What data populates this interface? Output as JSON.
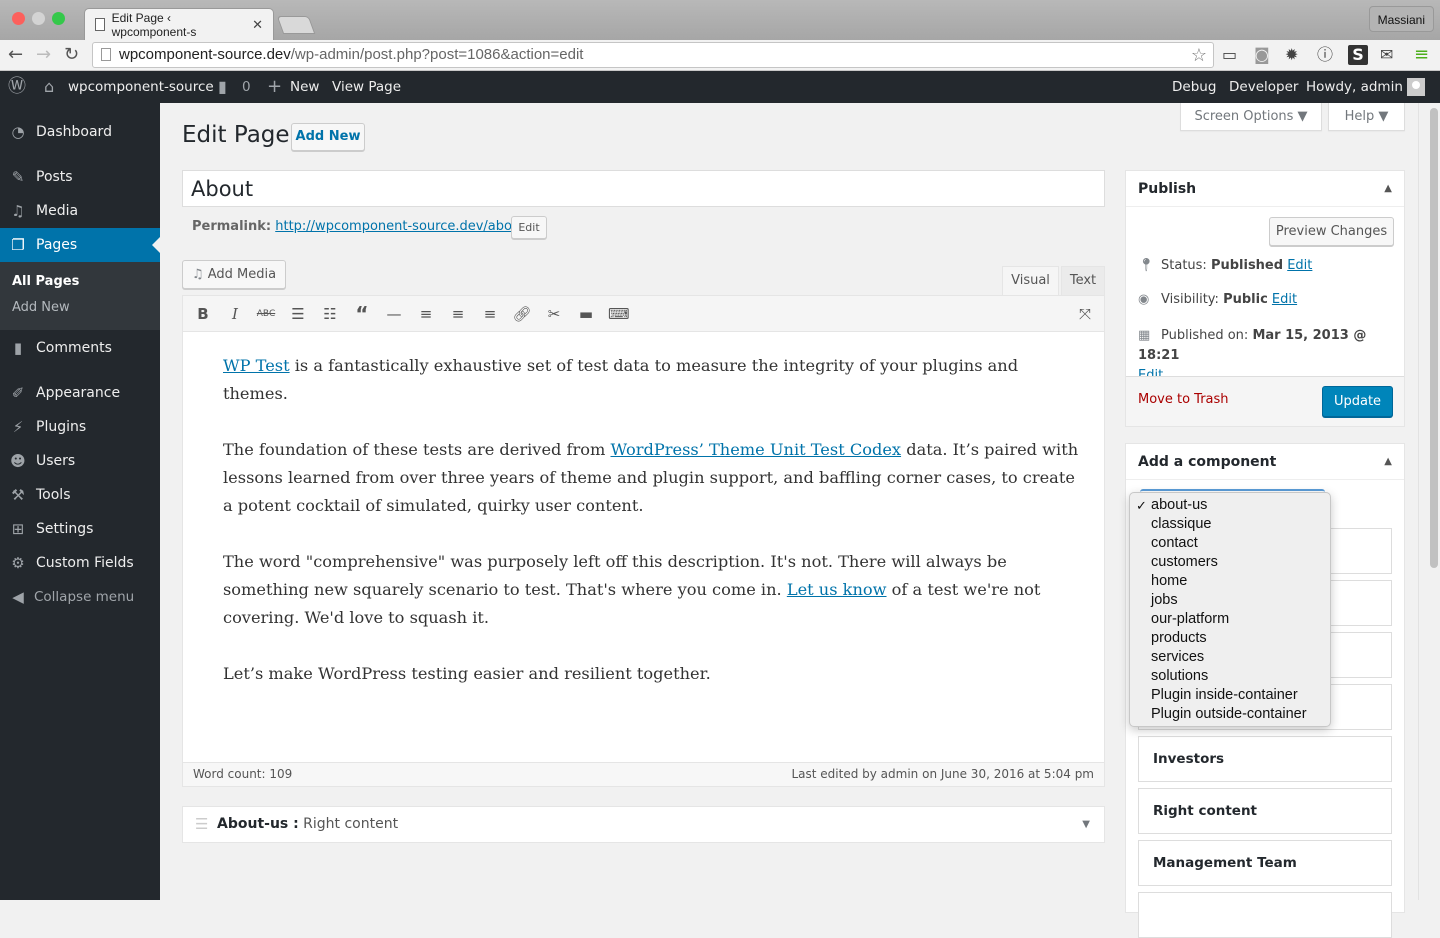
{
  "browser": {
    "tab_title": "Edit Page ‹ wpcomponent-s",
    "profile": "Massiani",
    "url_host": "wpcomponent-source.dev",
    "url_path": "/wp-admin/post.php?post=1086&action=edit"
  },
  "adminbar": {
    "site": "wpcomponent-source",
    "comments": "0",
    "new": "New",
    "view": "View Page",
    "debug": "Debug",
    "developer": "Developer",
    "howdy": "Howdy, admin"
  },
  "sidebar": {
    "items": [
      {
        "label": "Dashboard",
        "icon": "dashboard-icon"
      },
      {
        "label": "Posts",
        "icon": "pin-icon"
      },
      {
        "label": "Media",
        "icon": "media-icon"
      },
      {
        "label": "Pages",
        "icon": "pages-icon"
      },
      {
        "label": "Comments",
        "icon": "comment-icon"
      },
      {
        "label": "Appearance",
        "icon": "brush-icon"
      },
      {
        "label": "Plugins",
        "icon": "plug-icon"
      },
      {
        "label": "Users",
        "icon": "user-icon"
      },
      {
        "label": "Tools",
        "icon": "wrench-icon"
      },
      {
        "label": "Settings",
        "icon": "settings-icon"
      },
      {
        "label": "Custom Fields",
        "icon": "gear-icon"
      }
    ],
    "submenu": [
      "All Pages",
      "Add New"
    ],
    "collapse": "Collapse menu"
  },
  "screen_options": "Screen Options ▼",
  "help": "Help ▼",
  "page": {
    "heading": "Edit Page",
    "add_new": "Add New",
    "title_value": "About",
    "permalink_label": "Permalink:",
    "permalink_url": "http://wpcomponent-source.dev/about/",
    "permalink_edit": "Edit",
    "add_media": "Add Media",
    "tab_visual": "Visual",
    "tab_text": "Text"
  },
  "content": {
    "p1_link": "WP Test",
    "p1_rest": " is a fantastically exhaustive set of test data to measure the integrity of your plugins and themes.",
    "p2_a": "The foundation of these tests are derived from ",
    "p2_link": "WordPress’ Theme Unit Test Codex",
    "p2_b": " data. It’s paired with lessons learned from over three years of theme and plugin support, and baffling corner cases, to create a potent cocktail of simulated, quirky user content.",
    "p3_a": "The word \"comprehensive\" was purposely left off this description. It's not. There will always be something new squarely scenario to test. That's where you come in. ",
    "p3_link": "Let us know",
    "p3_b": " of a test we're not covering. We'd love to squash it.",
    "p4": "Let’s make WordPress testing easier and resilient together."
  },
  "status": {
    "word_count": "Word count: 109",
    "last_edited": "Last edited by admin on June 30, 2016 at 5:04 pm"
  },
  "component_row": {
    "name": "About-us :",
    "value": " Right content"
  },
  "publish": {
    "title": "Publish",
    "preview": "Preview Changes",
    "status_label": "Status: ",
    "status_value": "Published",
    "visibility_label": "Visibility: ",
    "visibility_value": "Public",
    "published_label": "Published on: ",
    "published_value": "Mar 15, 2013 @ 18:21",
    "edit": "Edit",
    "trash": "Move to Trash",
    "update": "Update"
  },
  "component": {
    "title": "Add a component",
    "selected": "about-us",
    "options": [
      "about-us",
      "classique",
      "contact",
      "customers",
      "home",
      "jobs",
      "our-platform",
      "products",
      "services",
      "solutions",
      "Plugin inside-container",
      "Plugin outside-container"
    ],
    "boxes": [
      "Investors",
      "Right content",
      "Management Team"
    ]
  }
}
